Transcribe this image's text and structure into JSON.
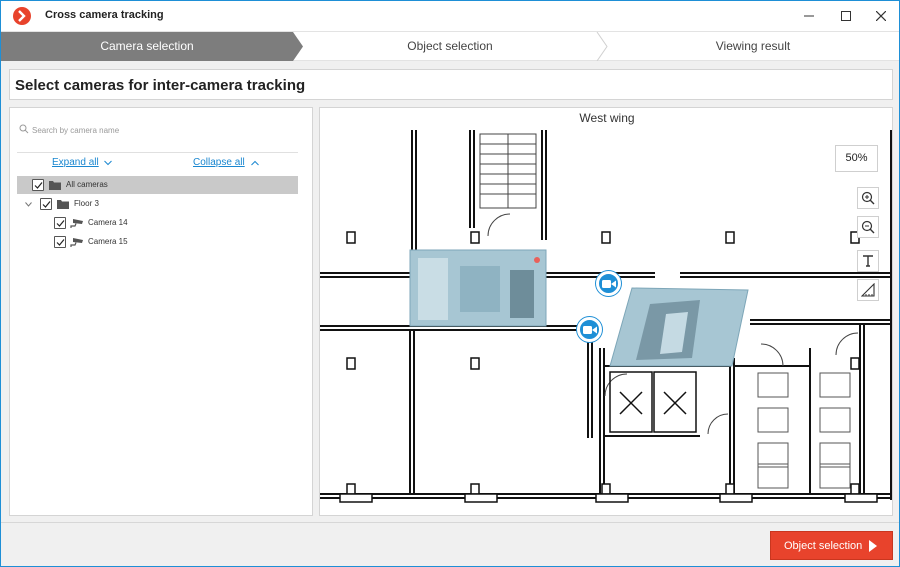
{
  "window": {
    "title": "Cross camera tracking",
    "icon": "app-logo-icon",
    "accent_color": "#1e8fd6",
    "brand_color": "#e8432c"
  },
  "steps": [
    {
      "label": "Camera selection",
      "active": true
    },
    {
      "label": "Object selection",
      "active": false
    },
    {
      "label": "Viewing result",
      "active": false
    }
  ],
  "header": {
    "title": "Select cameras for inter-camera tracking"
  },
  "sidebar": {
    "search_placeholder": "Search by camera name",
    "expand_all": "Expand all",
    "collapse_all": "Collapse all",
    "tree": {
      "root": {
        "label": "All cameras",
        "checked": true
      },
      "group": {
        "label": "Floor 3",
        "checked": true
      },
      "cameras": [
        {
          "label": "Camera 14",
          "checked": true
        },
        {
          "label": "Camera 15",
          "checked": true
        }
      ]
    }
  },
  "map": {
    "title": "West wing",
    "zoom": "50%",
    "tools": [
      "zoom-in-icon",
      "zoom-out-icon",
      "text-tool-icon",
      "ruler-tool-icon"
    ]
  },
  "footer": {
    "next_button": "Object selection"
  }
}
